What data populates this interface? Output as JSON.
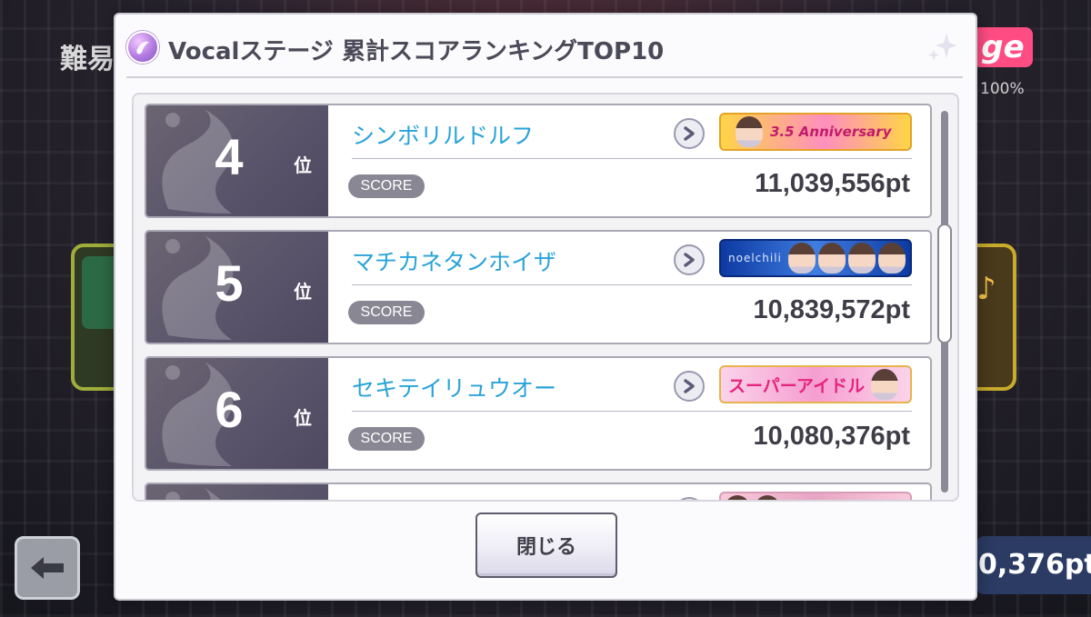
{
  "background": {
    "difficulty_label_partial": "難易",
    "logo_partial": "ge",
    "percent": "100%",
    "score_tail": "0,376pt"
  },
  "modal": {
    "title": "Vocalステージ 累計スコアランキングTOP10",
    "close_label": "閉じる"
  },
  "rank_suffix": "位",
  "score_label": "SCORE",
  "rankings": [
    {
      "rank": "4",
      "name": "シンボリルドルフ",
      "score": "11,039,556pt",
      "banner_text": "3.5 Anniversary"
    },
    {
      "rank": "5",
      "name": "マチカネタンホイザ",
      "score": "10,839,572pt",
      "banner_text": "noelchili"
    },
    {
      "rank": "6",
      "name": "セキテイリュウオー",
      "score": "10,080,376pt",
      "banner_text": "スーパーアイドル"
    },
    {
      "rank": "",
      "name": "",
      "score": "",
      "banner_text": ""
    }
  ],
  "colors": {
    "name_text": "#29a3d8",
    "rank_badge": "#5e586e",
    "score_badge": "#8a8794"
  }
}
